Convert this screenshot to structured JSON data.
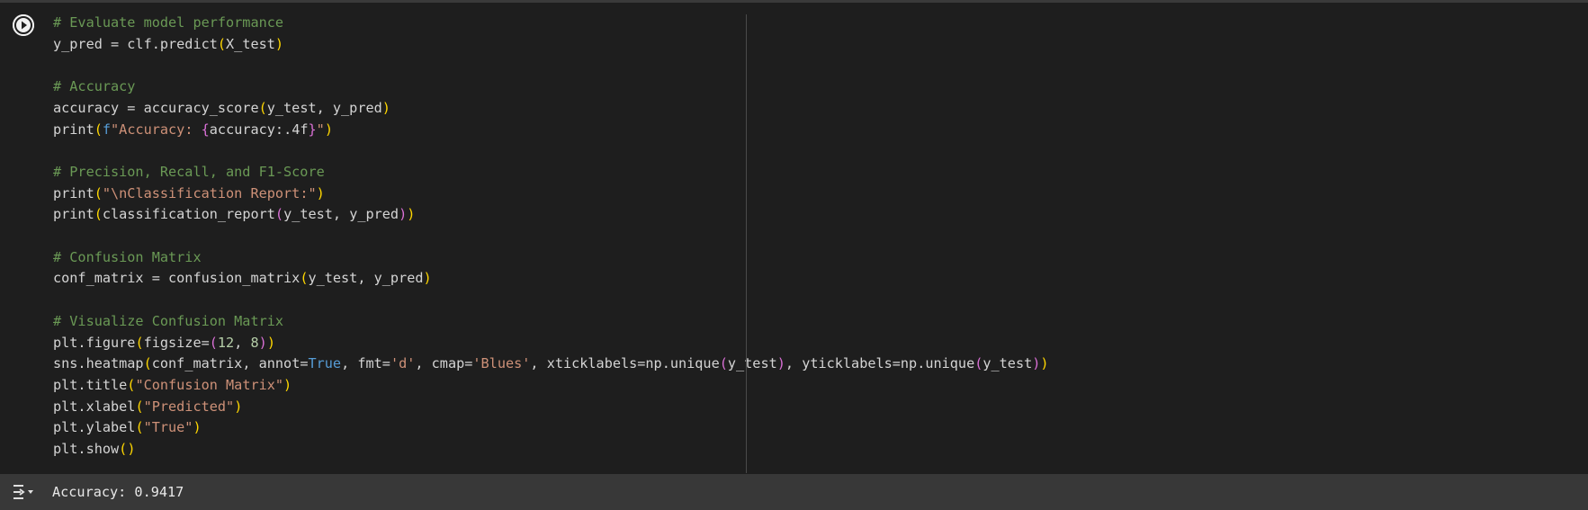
{
  "cell": {
    "run_button_icon": "play-circle-icon",
    "lines": [
      [
        {
          "t": "# Evaluate model performance",
          "c": "comment"
        }
      ],
      [
        {
          "t": "y_pred = clf.predict",
          "c": "default"
        },
        {
          "t": "(",
          "c": "paren1"
        },
        {
          "t": "X_test",
          "c": "default"
        },
        {
          "t": ")",
          "c": "paren1"
        }
      ],
      [],
      [
        {
          "t": "# Accuracy",
          "c": "comment"
        }
      ],
      [
        {
          "t": "accuracy = accuracy_score",
          "c": "default"
        },
        {
          "t": "(",
          "c": "paren1"
        },
        {
          "t": "y_test, y_pred",
          "c": "default"
        },
        {
          "t": ")",
          "c": "paren1"
        }
      ],
      [
        {
          "t": "print",
          "c": "default"
        },
        {
          "t": "(",
          "c": "paren1"
        },
        {
          "t": "f",
          "c": "fprefix"
        },
        {
          "t": "\"Accuracy: ",
          "c": "string"
        },
        {
          "t": "{",
          "c": "paren2"
        },
        {
          "t": "accuracy:.4f",
          "c": "default"
        },
        {
          "t": "}",
          "c": "paren2"
        },
        {
          "t": "\"",
          "c": "string"
        },
        {
          "t": ")",
          "c": "paren1"
        }
      ],
      [],
      [
        {
          "t": "# Precision, Recall, and F1-Score",
          "c": "comment"
        }
      ],
      [
        {
          "t": "print",
          "c": "default"
        },
        {
          "t": "(",
          "c": "paren1"
        },
        {
          "t": "\"\\nClassification Report:\"",
          "c": "string"
        },
        {
          "t": ")",
          "c": "paren1"
        }
      ],
      [
        {
          "t": "print",
          "c": "default"
        },
        {
          "t": "(",
          "c": "paren1"
        },
        {
          "t": "classification_report",
          "c": "default"
        },
        {
          "t": "(",
          "c": "paren2"
        },
        {
          "t": "y_test, y_pred",
          "c": "default"
        },
        {
          "t": ")",
          "c": "paren2"
        },
        {
          "t": ")",
          "c": "paren1"
        }
      ],
      [],
      [
        {
          "t": "# Confusion Matrix",
          "c": "comment"
        }
      ],
      [
        {
          "t": "conf_matrix = confusion_matrix",
          "c": "default"
        },
        {
          "t": "(",
          "c": "paren1"
        },
        {
          "t": "y_test, y_pred",
          "c": "default"
        },
        {
          "t": ")",
          "c": "paren1"
        }
      ],
      [],
      [
        {
          "t": "# Visualize Confusion Matrix",
          "c": "comment"
        }
      ],
      [
        {
          "t": "plt.figure",
          "c": "default"
        },
        {
          "t": "(",
          "c": "paren1"
        },
        {
          "t": "figsize=",
          "c": "default"
        },
        {
          "t": "(",
          "c": "paren2"
        },
        {
          "t": "12",
          "c": "number"
        },
        {
          "t": ", ",
          "c": "default"
        },
        {
          "t": "8",
          "c": "number"
        },
        {
          "t": ")",
          "c": "paren2"
        },
        {
          "t": ")",
          "c": "paren1"
        }
      ],
      [
        {
          "t": "sns.heatmap",
          "c": "default"
        },
        {
          "t": "(",
          "c": "paren1"
        },
        {
          "t": "conf_matrix, annot=",
          "c": "default"
        },
        {
          "t": "True",
          "c": "const"
        },
        {
          "t": ", fmt=",
          "c": "default"
        },
        {
          "t": "'d'",
          "c": "string"
        },
        {
          "t": ", cmap=",
          "c": "default"
        },
        {
          "t": "'Blues'",
          "c": "string"
        },
        {
          "t": ", xticklabels=np.unique",
          "c": "default"
        },
        {
          "t": "(",
          "c": "paren2"
        },
        {
          "t": "y_test",
          "c": "default"
        },
        {
          "t": ")",
          "c": "paren2"
        },
        {
          "t": ", yticklabels=np.unique",
          "c": "default"
        },
        {
          "t": "(",
          "c": "paren2"
        },
        {
          "t": "y_test",
          "c": "default"
        },
        {
          "t": ")",
          "c": "paren2"
        },
        {
          "t": ")",
          "c": "paren1"
        }
      ],
      [
        {
          "t": "plt.title",
          "c": "default"
        },
        {
          "t": "(",
          "c": "paren1"
        },
        {
          "t": "\"Confusion Matrix\"",
          "c": "string"
        },
        {
          "t": ")",
          "c": "paren1"
        }
      ],
      [
        {
          "t": "plt.xlabel",
          "c": "default"
        },
        {
          "t": "(",
          "c": "paren1"
        },
        {
          "t": "\"Predicted\"",
          "c": "string"
        },
        {
          "t": ")",
          "c": "paren1"
        }
      ],
      [
        {
          "t": "plt.ylabel",
          "c": "default"
        },
        {
          "t": "(",
          "c": "paren1"
        },
        {
          "t": "\"True\"",
          "c": "string"
        },
        {
          "t": ")",
          "c": "paren1"
        }
      ],
      [
        {
          "t": "plt.show",
          "c": "default"
        },
        {
          "t": "(",
          "c": "paren1"
        },
        {
          "t": ")",
          "c": "paren1"
        }
      ]
    ]
  },
  "output": {
    "toggle_icon": "output-collapse-icon",
    "text": "Accuracy: 0.9417"
  },
  "colors": {
    "cell_background": "#1e1e1e",
    "output_background": "#383838",
    "comment": "#6a9955",
    "string": "#ce9178",
    "keyword": "#569cd6",
    "bracket_level1": "#ffd700",
    "bracket_level2": "#da70d6"
  }
}
